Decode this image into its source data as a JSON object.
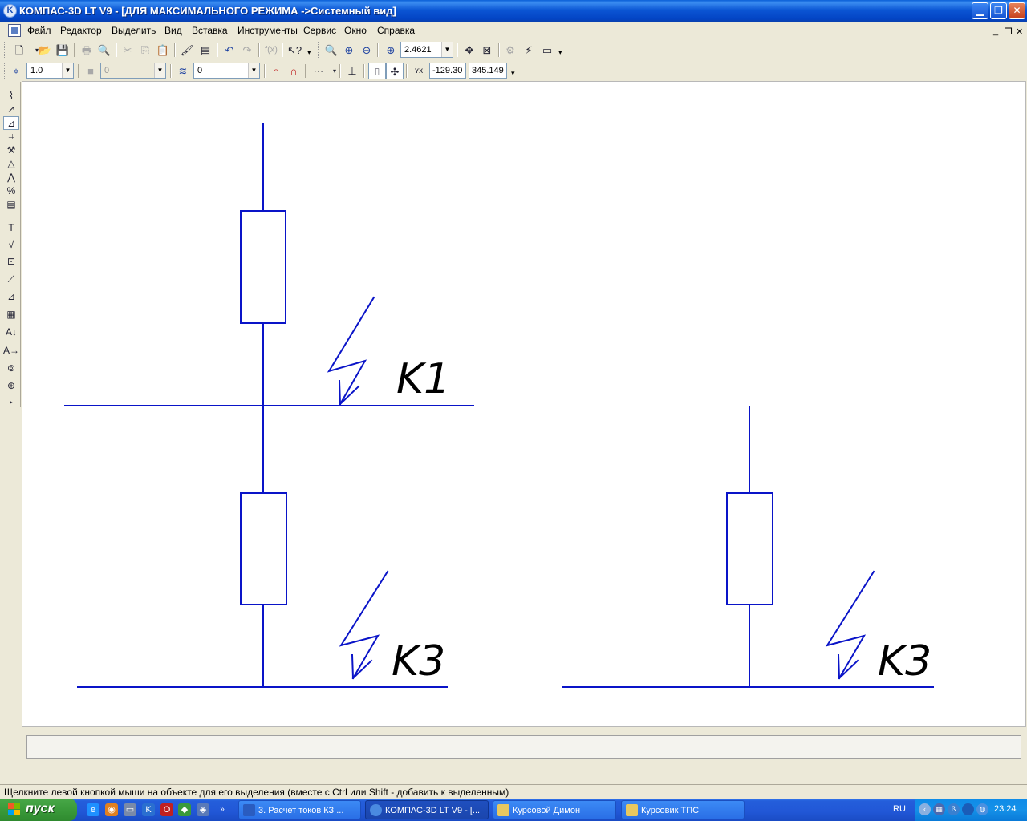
{
  "window": {
    "title": "КОМПАС-3D LT V9 - [ДЛЯ МАКСИМАЛЬНОГО РЕЖИМА ->Системный вид]",
    "app_icon": "kompas-logo-icon"
  },
  "menu": {
    "items": [
      "Файл",
      "Редактор",
      "Выделить",
      "Вид",
      "Вставка",
      "Инструменты",
      "Сервис",
      "Окно",
      "Справка"
    ]
  },
  "toolbar_standard": {
    "zoom_value": "2.4621"
  },
  "toolbar_current_state": {
    "step_value": "1.0",
    "style_value": "0",
    "layer_value": "0",
    "coord_x": "-129.30",
    "coord_y": "345.149"
  },
  "drawing": {
    "line_color": "#0a14c8",
    "labels": {
      "k1": "K1",
      "k3_left": "K3",
      "k3_right": "K3"
    }
  },
  "status": {
    "hint": "Щелкните левой кнопкой мыши на объекте для его выделения (вместе с Ctrl или Shift - добавить к выделенным)"
  },
  "taskbar": {
    "start_label": "пуск",
    "tasks": [
      "3. Расчет токов КЗ ...",
      "КОМПАС-3D LT V9 - [...",
      "Курсовой Димон",
      "Курсовик ТПС"
    ],
    "language": "RU",
    "clock": "23:24"
  }
}
